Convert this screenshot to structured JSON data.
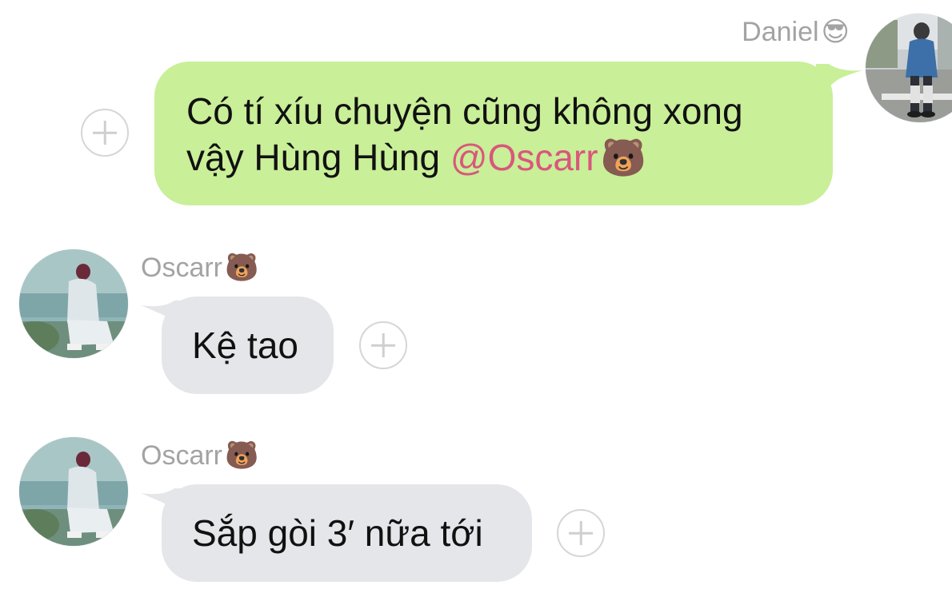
{
  "messages": [
    {
      "sender": "Daniel",
      "sender_emoji": "😎",
      "direction": "outgoing",
      "text_line1": "Có tí xíu chuyện cũng không xong",
      "text_line2_before": "vậy Hùng Hùng ",
      "mention": "@Oscarr",
      "text_emoji": "🐻"
    },
    {
      "sender": "Oscarr",
      "sender_emoji": "🐻",
      "direction": "incoming",
      "text": "Kệ tao"
    },
    {
      "sender": "Oscarr",
      "sender_emoji": "🐻",
      "direction": "incoming",
      "text": "Sắp gòi 3′ nữa tới"
    }
  ],
  "icons": {
    "reaction_button": "plus-circle-icon"
  },
  "colors": {
    "outgoing_bubble": "#c9ef98",
    "incoming_bubble": "#e5e6e9",
    "mention": "#d9577c",
    "sender_name": "#a3a3a3"
  }
}
